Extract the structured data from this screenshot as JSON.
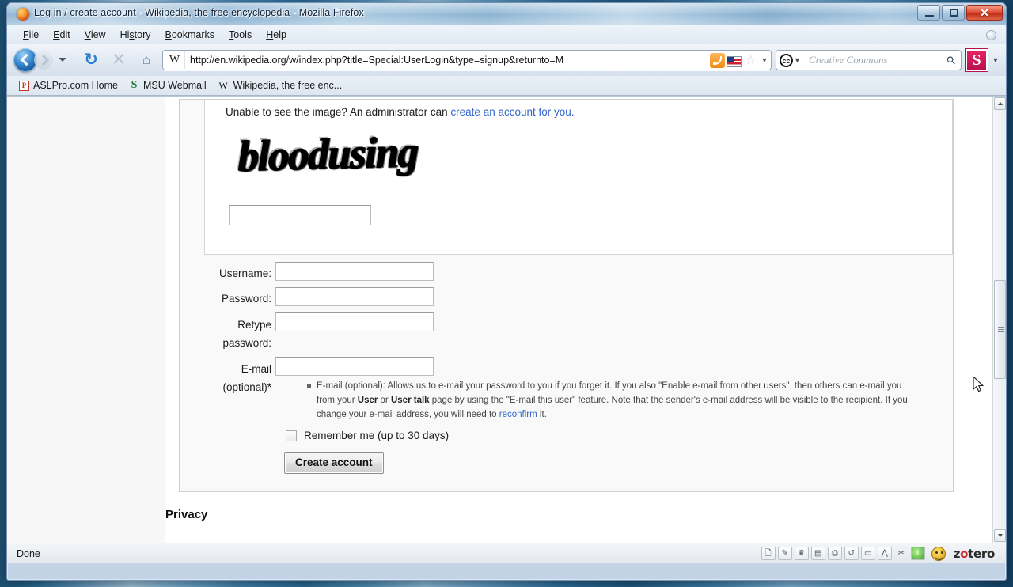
{
  "window": {
    "title": "Log in / create account - Wikipedia, the free encyclopedia - Mozilla Firefox",
    "firefox_icon": "firefox-logo-icon",
    "minimize_label": "Minimize",
    "restore_label": "Restore",
    "close_label": "✕"
  },
  "menubar": {
    "items": [
      {
        "label": "File"
      },
      {
        "label": "Edit"
      },
      {
        "label": "View"
      },
      {
        "label": "History"
      },
      {
        "label": "Bookmarks"
      },
      {
        "label": "Tools"
      },
      {
        "label": "Help"
      }
    ]
  },
  "navbar": {
    "back_icon": "back-arrow-icon",
    "forward_icon": "forward-arrow-icon",
    "history_dropdown_icon": "chevron-down-icon",
    "reload_icon": "↻",
    "stop_icon": "✕",
    "home_icon": "⌂",
    "site_favicon": "W",
    "url": "http://en.wikipedia.org/w/index.php?title=Special:UserLogin&type=signup&returnto=M",
    "feed_icon": "rss-feed-icon",
    "flag_icon": "us-flag-icon",
    "bookmark_star_icon": "☆",
    "url_dropdown_icon": "▼"
  },
  "search": {
    "engine_icon": "creative-commons-icon",
    "engine_caret": "▼",
    "placeholder": "Creative Commons",
    "magnifier_icon": "⚲",
    "extension_icon": "S",
    "toolbar_caret": "▼"
  },
  "bookmarks_toolbar": {
    "items": [
      {
        "icon": "aslpro-favicon",
        "glyph": "P",
        "label": "ASLPro.com Home"
      },
      {
        "icon": "msu-favicon",
        "glyph": "S",
        "label": "MSU Webmail"
      },
      {
        "icon": "wikipedia-favicon",
        "glyph": "W",
        "label": "Wikipedia, the free enc..."
      }
    ]
  },
  "page": {
    "captcha": {
      "note_prefix": "Unable to see the image? An administrator can ",
      "note_link": "create an account for you.",
      "image_text": "bloodusing",
      "answer_value": "",
      "answer_placeholder": ""
    },
    "form": {
      "fields": [
        {
          "label": "Username:",
          "value": "",
          "name": "username"
        },
        {
          "label": "Password:",
          "value": "",
          "name": "password"
        },
        {
          "label": "Retype password:",
          "value": "",
          "name": "retype-password"
        },
        {
          "label": "E-mail (optional)*",
          "value": "",
          "name": "email"
        }
      ],
      "help_text_1": "E-mail (optional): Allows us to e-mail your password to you if you forget it. If you also \"Enable e-mail from other users\", then others can e-mail you from your ",
      "help_bold_user": "User",
      "help_text_2": " or ",
      "help_bold_usertalk": "User talk",
      "help_text_3": " page by using the \"E-mail this user\" feature. Note that the sender's e-mail address will be visible to the recipient. If you change your e-mail address, you will need to ",
      "help_link": "reconfirm",
      "help_text_4": " it.",
      "remember_label": "Remember me (up to 30 days)",
      "remember_checked": false,
      "submit_label": "Create account"
    },
    "footer_heading": "Privacy",
    "scrollbar": {
      "up_arrow": "▲",
      "down_arrow": "▼"
    }
  },
  "statusbar": {
    "status": "Done",
    "icons": [
      {
        "name": "new-document-icon",
        "glyph": "🗋"
      },
      {
        "name": "pen-icon",
        "glyph": "✎"
      },
      {
        "name": "trophy-icon",
        "glyph": "♛"
      },
      {
        "name": "save-icon",
        "glyph": "▤"
      },
      {
        "name": "printer-icon",
        "glyph": "⎙"
      },
      {
        "name": "undo-icon",
        "glyph": "↺"
      },
      {
        "name": "note-icon",
        "glyph": "▭"
      },
      {
        "name": "chart-icon",
        "glyph": "⋀"
      },
      {
        "name": "tools-icon",
        "glyph": "✂"
      },
      {
        "name": "info-icon",
        "glyph": "●"
      }
    ],
    "zotero_icon": "zotero-face-icon",
    "zotero_label_1": "z",
    "zotero_label_accent": "o",
    "zotero_label_2": "tero"
  },
  "colors": {
    "link": "#3366cc",
    "close_button": "#c02d18",
    "accent_blue": "#14579e",
    "zotero_red": "#cc2b2b"
  }
}
